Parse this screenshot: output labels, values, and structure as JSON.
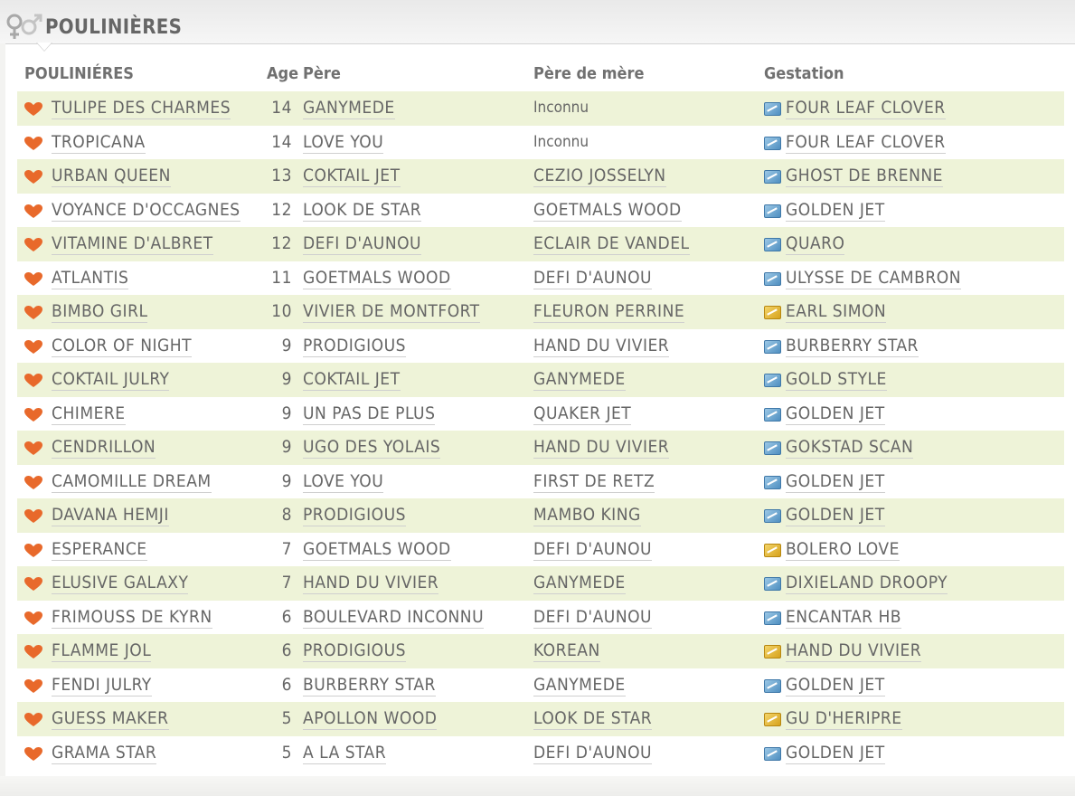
{
  "header": {
    "title": "POULINIÈRES"
  },
  "columns": {
    "name": "POULINIÉRES",
    "age": "Age",
    "pere": "Père",
    "pere_de_mere": "Père de mère",
    "gestation": "Gestation"
  },
  "colors": {
    "row_alt": "#eef3d8",
    "heart": "#e8692b",
    "gest_blue": "#4f8fc0",
    "gest_gold": "#d6a21d"
  },
  "rows": [
    {
      "name": "TULIPE DES CHARMES",
      "age": "14",
      "pere": "GANYMEDE",
      "pere_de_mere": "Inconnu",
      "gestation": "FOUR LEAF CLOVER",
      "gest_icon": "blue"
    },
    {
      "name": "TROPICANA",
      "age": "14",
      "pere": "LOVE YOU",
      "pere_de_mere": "Inconnu",
      "gestation": "FOUR LEAF CLOVER",
      "gest_icon": "blue"
    },
    {
      "name": "URBAN QUEEN",
      "age": "13",
      "pere": "COKTAIL JET",
      "pere_de_mere": "CEZIO JOSSELYN",
      "gestation": "GHOST DE BRENNE",
      "gest_icon": "blue"
    },
    {
      "name": "VOYANCE D'OCCAGNES",
      "age": "12",
      "pere": "LOOK DE STAR",
      "pere_de_mere": "GOETMALS WOOD",
      "gestation": "GOLDEN JET",
      "gest_icon": "blue"
    },
    {
      "name": "VITAMINE D'ALBRET",
      "age": "12",
      "pere": "DEFI D'AUNOU",
      "pere_de_mere": "ECLAIR DE VANDEL",
      "gestation": "QUARO",
      "gest_icon": "blue"
    },
    {
      "name": "ATLANTIS",
      "age": "11",
      "pere": "GOETMALS WOOD",
      "pere_de_mere": "DEFI D'AUNOU",
      "gestation": "ULYSSE DE CAMBRON",
      "gest_icon": "blue"
    },
    {
      "name": "BIMBO GIRL",
      "age": "10",
      "pere": "VIVIER DE MONTFORT",
      "pere_de_mere": "FLEURON PERRINE",
      "gestation": "EARL SIMON",
      "gest_icon": "gold"
    },
    {
      "name": "COLOR OF NIGHT",
      "age": "9",
      "pere": "PRODIGIOUS",
      "pere_de_mere": "HAND DU VIVIER",
      "gestation": "BURBERRY STAR",
      "gest_icon": "blue"
    },
    {
      "name": "COKTAIL JULRY",
      "age": "9",
      "pere": "COKTAIL JET",
      "pere_de_mere": "GANYMEDE",
      "gestation": "GOLD STYLE",
      "gest_icon": "blue"
    },
    {
      "name": "CHIMERE",
      "age": "9",
      "pere": "UN PAS DE PLUS",
      "pere_de_mere": "QUAKER JET",
      "gestation": "GOLDEN JET",
      "gest_icon": "blue"
    },
    {
      "name": "CENDRILLON",
      "age": "9",
      "pere": "UGO DES YOLAIS",
      "pere_de_mere": "HAND DU VIVIER",
      "gestation": "GOKSTAD SCAN",
      "gest_icon": "blue"
    },
    {
      "name": "CAMOMILLE DREAM",
      "age": "9",
      "pere": "LOVE YOU",
      "pere_de_mere": "FIRST DE RETZ",
      "gestation": "GOLDEN JET",
      "gest_icon": "blue"
    },
    {
      "name": "DAVANA HEMJI",
      "age": "8",
      "pere": "PRODIGIOUS",
      "pere_de_mere": "MAMBO KING",
      "gestation": "GOLDEN JET",
      "gest_icon": "blue"
    },
    {
      "name": "ESPERANCE",
      "age": "7",
      "pere": "GOETMALS WOOD",
      "pere_de_mere": "DEFI D'AUNOU",
      "gestation": "BOLERO LOVE",
      "gest_icon": "gold"
    },
    {
      "name": "ELUSIVE GALAXY",
      "age": "7",
      "pere": "HAND DU VIVIER",
      "pere_de_mere": "GANYMEDE",
      "gestation": "DIXIELAND DROOPY",
      "gest_icon": "blue"
    },
    {
      "name": "FRIMOUSS DE KYRN",
      "age": "6",
      "pere": "BOULEVARD INCONNU",
      "pere_de_mere": "DEFI D'AUNOU",
      "gestation": "ENCANTAR HB",
      "gest_icon": "blue"
    },
    {
      "name": "FLAMME JOL",
      "age": "6",
      "pere": "PRODIGIOUS",
      "pere_de_mere": "KOREAN",
      "gestation": "HAND DU VIVIER",
      "gest_icon": "gold"
    },
    {
      "name": "FENDI JULRY",
      "age": "6",
      "pere": "BURBERRY STAR",
      "pere_de_mere": "GANYMEDE",
      "gestation": "GOLDEN JET",
      "gest_icon": "blue"
    },
    {
      "name": "GUESS MAKER",
      "age": "5",
      "pere": "APOLLON WOOD",
      "pere_de_mere": "LOOK DE STAR",
      "gestation": "GU D'HERIPRE",
      "gest_icon": "gold"
    },
    {
      "name": "GRAMA STAR",
      "age": "5",
      "pere": "A LA STAR",
      "pere_de_mere": "DEFI D'AUNOU",
      "gestation": "GOLDEN JET",
      "gest_icon": "blue"
    }
  ]
}
